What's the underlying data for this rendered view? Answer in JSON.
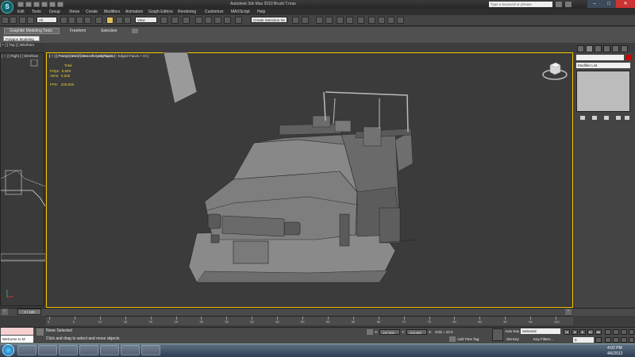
{
  "window": {
    "title": "Autodesk 3ds Max 2010      Brush T.max",
    "search_placeholder": "Type a keyword or phrase"
  },
  "menu": [
    "Edit",
    "Tools",
    "Group",
    "Views",
    "Create",
    "Modifiers",
    "Animation",
    "Graph Editors",
    "Rendering",
    "Customize",
    "MAXScript",
    "Help"
  ],
  "toolbar": {
    "selection_filter": "All",
    "ref_coord": "View",
    "named_selection": "Create Selection Se"
  },
  "ribbon": {
    "tabs": [
      "Graphite Modeling Tools",
      "Freeform",
      "Selection"
    ],
    "panel_button": "Polygon Modeling"
  },
  "viewports": {
    "top_label": "[ + ] [ Top ] [ Wirefram",
    "right_label": "[ + ] [ Right ] [ Wirefram",
    "front_label": "[ + ] [ Front ] [ Wireframe + Edged Faces ]",
    "persp_label": "[ + ] [ Perspective ] [ Smooth + Highlights + Edged Faces + HI ]"
  },
  "stats": {
    "header": "Total",
    "polys_label": "Polys:",
    "polys": "5,929",
    "verts_label": "Verts:",
    "verts": "6,525",
    "fps_label": "FPS:",
    "fps": "228.629"
  },
  "command_panel": {
    "modifier_list": "Modifier List",
    "color": "#cc0000"
  },
  "timeline": {
    "frame_display": "0 / 100",
    "ticks": [
      "0",
      "5",
      "10",
      "15",
      "20",
      "25",
      "30",
      "35",
      "40",
      "45",
      "50",
      "55",
      "60",
      "65",
      "70",
      "75",
      "80",
      "85",
      "90",
      "95",
      "100"
    ]
  },
  "status": {
    "selected_text": "None Selected",
    "prompt_text": "Click and drag to select and move objects",
    "maxscript_output": "Welcome to M",
    "x_value": "-197.830",
    "y_value": "-104.462",
    "z_value": "0.0",
    "grid_text": "Grid = 10.0",
    "add_time_tag": "Add Time Tag",
    "auto_key": "Auto Key",
    "selected_dropdown": "Selected",
    "set_key": "Set Key",
    "key_filters": "Key Filters...",
    "current_frame": "0"
  },
  "taskbar": {
    "time": "4:02 PM",
    "date": "4/6/2012"
  }
}
